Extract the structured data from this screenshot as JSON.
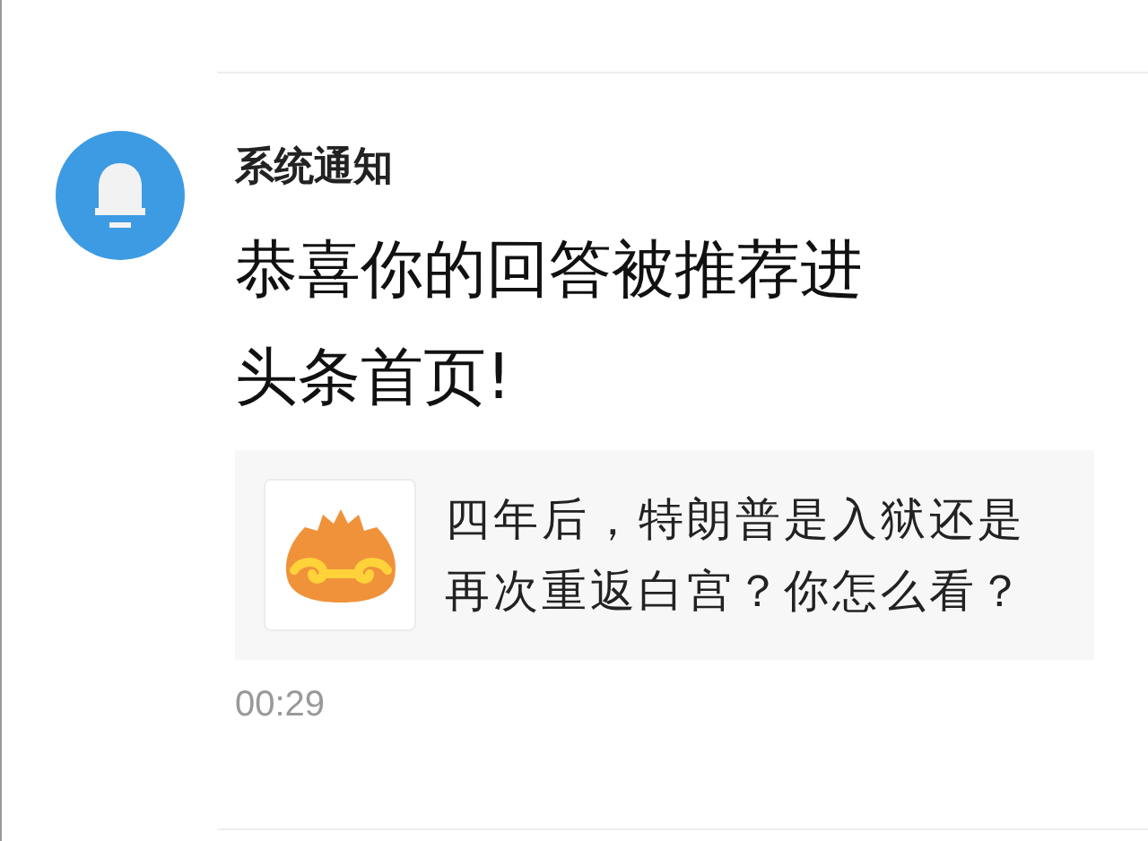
{
  "notification": {
    "sender": "系统通知",
    "headline": "恭喜你的回答被推荐进头条首页!",
    "card": {
      "question": "四年后，特朗普是入狱还是再次重返白宫？你怎么看？"
    },
    "time": "00:29"
  }
}
